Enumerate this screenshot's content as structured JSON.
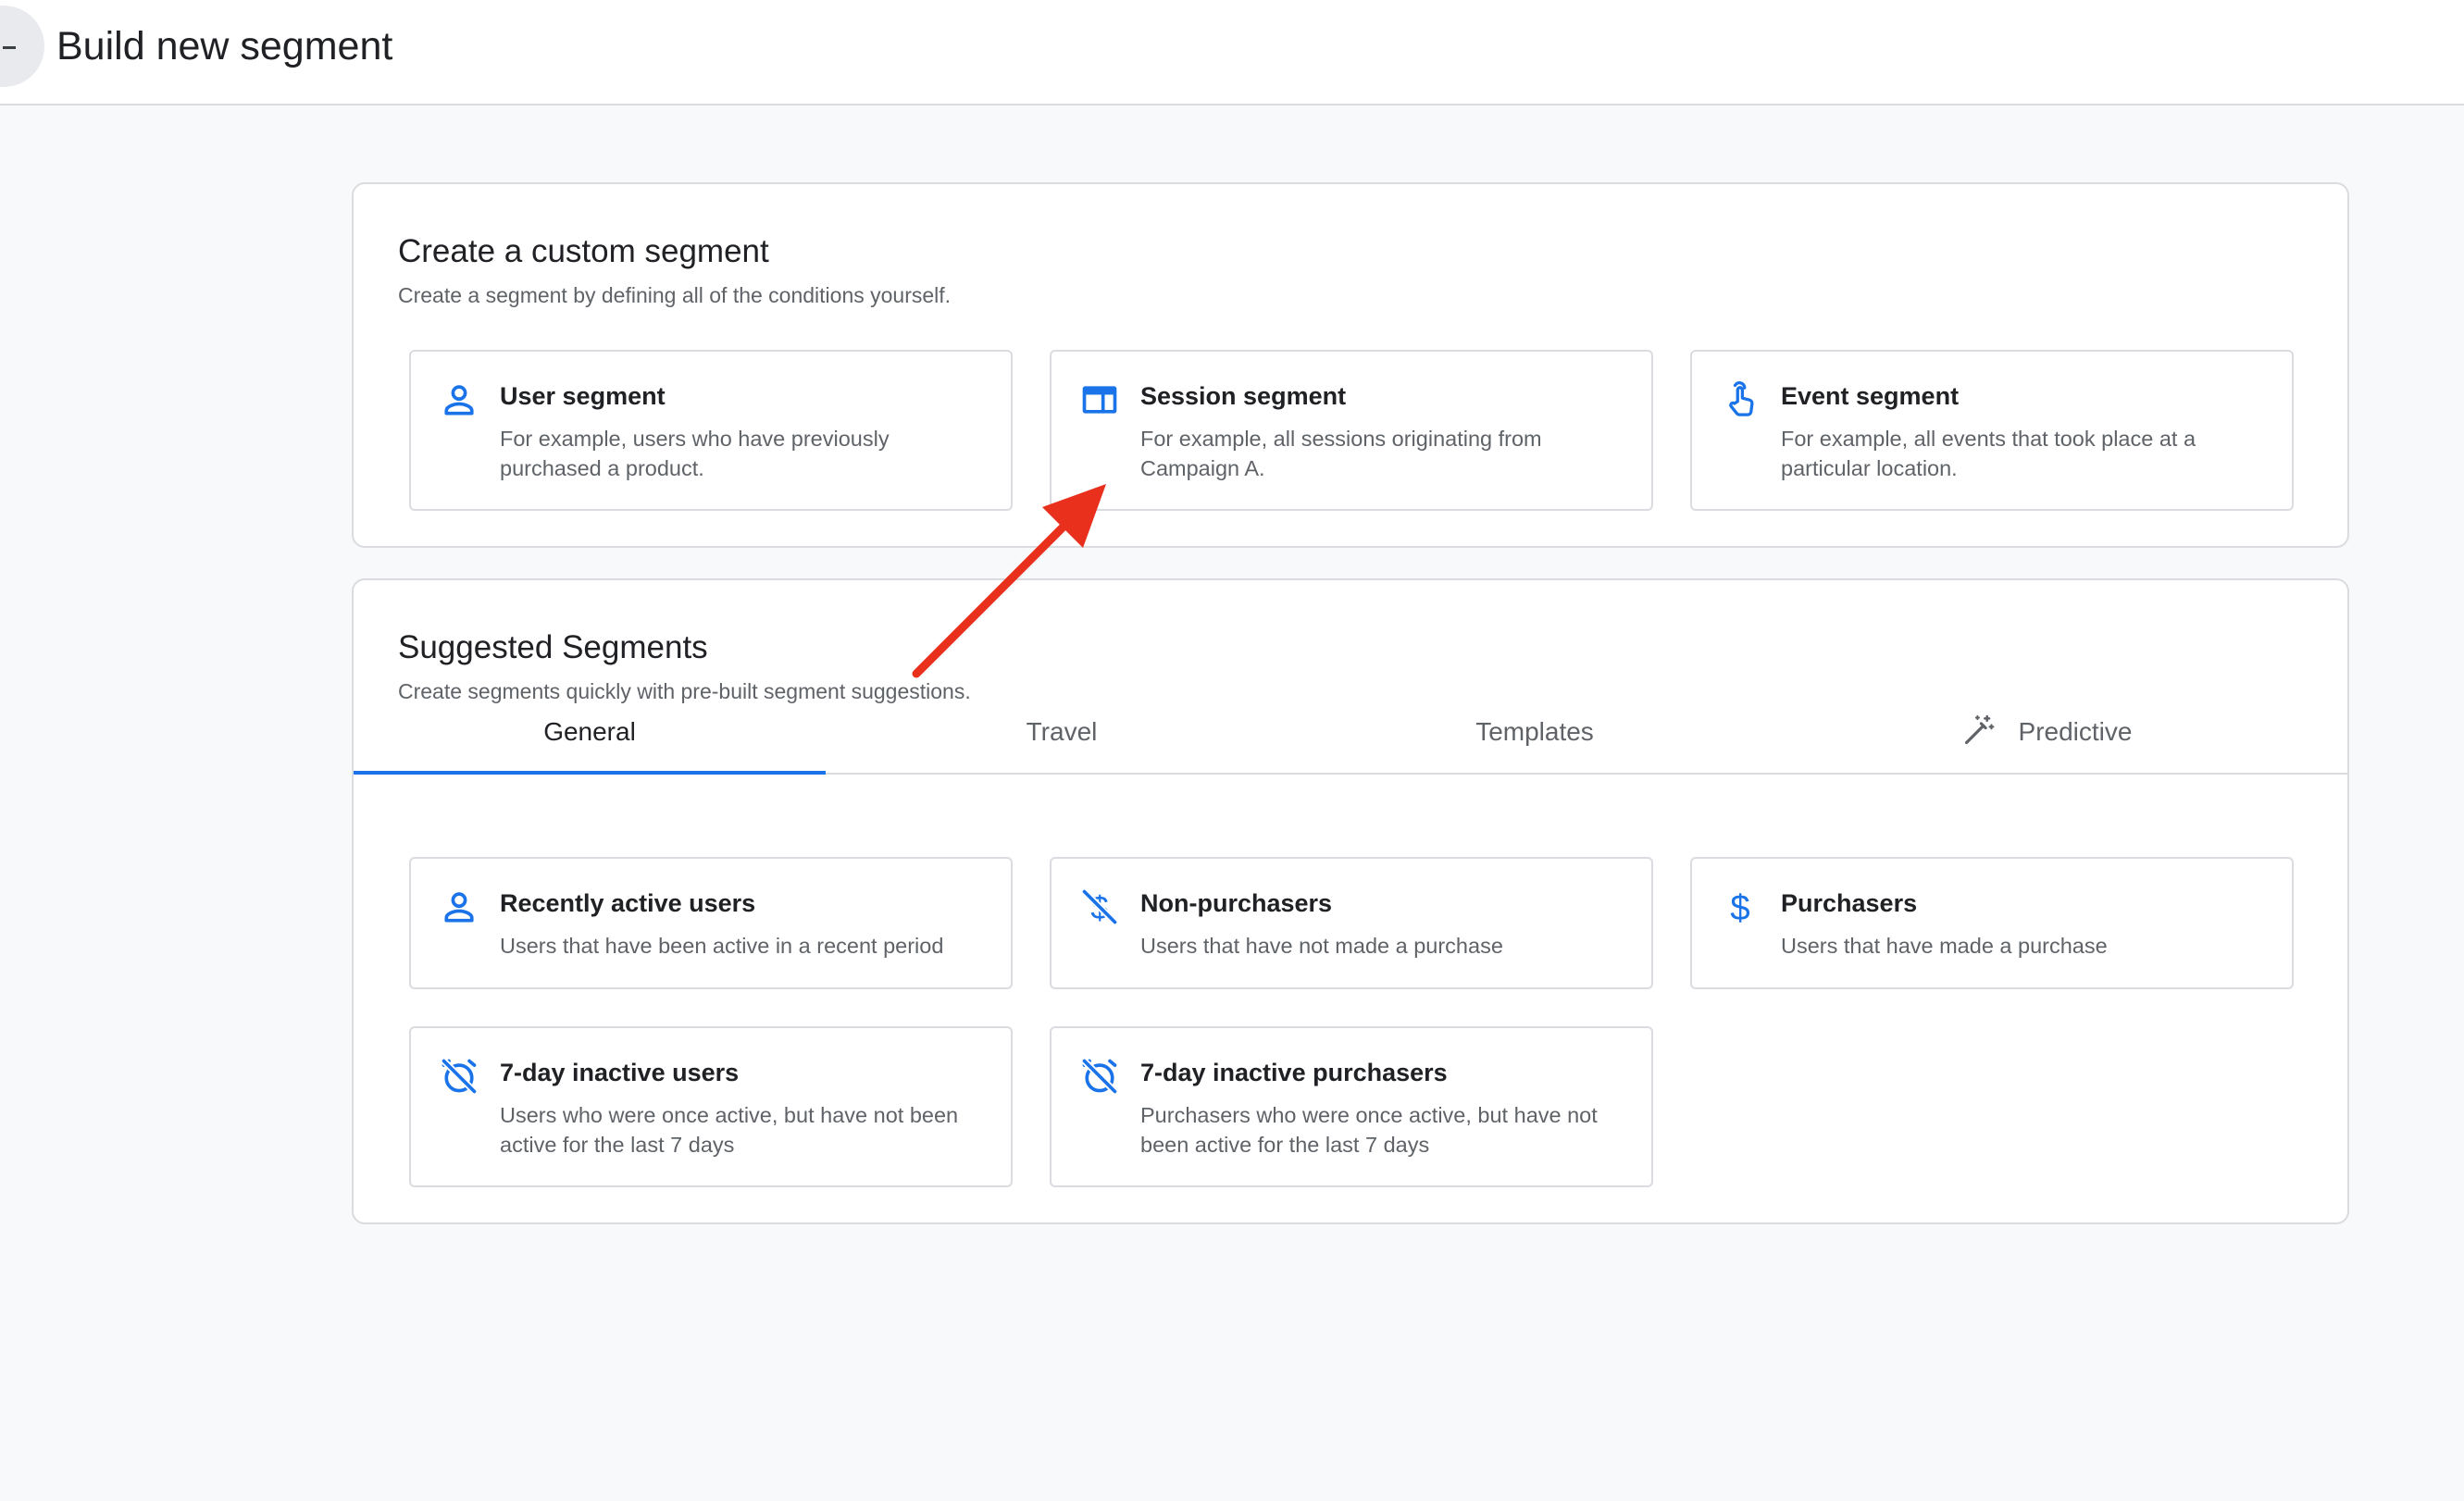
{
  "header": {
    "title": "Build new segment"
  },
  "custom": {
    "title": "Create a custom segment",
    "subtitle": "Create a segment by defining all of the conditions yourself.",
    "tiles": [
      {
        "icon": "person-icon",
        "title": "User segment",
        "desc": "For example, users who have previously purchased a product."
      },
      {
        "icon": "session-icon",
        "title": "Session segment",
        "desc": "For example, all sessions originating from Campaign A."
      },
      {
        "icon": "touch-icon",
        "title": "Event segment",
        "desc": "For example, all events that took place at a particular location."
      }
    ]
  },
  "suggested": {
    "title": "Suggested Segments",
    "subtitle": "Create segments quickly with pre-built segment suggestions.",
    "tabs": [
      {
        "label": "General",
        "active": true
      },
      {
        "label": "Travel",
        "active": false
      },
      {
        "label": "Templates",
        "active": false
      },
      {
        "label": "Predictive",
        "active": false,
        "icon": "magic-wand-icon"
      }
    ],
    "tiles": [
      {
        "icon": "person-icon",
        "title": "Recently active users",
        "desc": "Users that have been active in a recent period"
      },
      {
        "icon": "money-off-icon",
        "title": "Non-purchasers",
        "desc": "Users that have not made a purchase"
      },
      {
        "icon": "dollar-icon",
        "title": "Purchasers",
        "desc": "Users that have made a purchase"
      },
      {
        "icon": "alarm-off-icon",
        "title": "7-day inactive users",
        "desc": "Users who were once active, but have not been active for the last 7 days"
      },
      {
        "icon": "alarm-off-icon",
        "title": "7-day inactive purchasers",
        "desc": "Purchasers who were once active, but have not been active for the last 7 days"
      }
    ]
  },
  "colors": {
    "accent": "#1a73e8",
    "annotation": "#e8301c"
  }
}
